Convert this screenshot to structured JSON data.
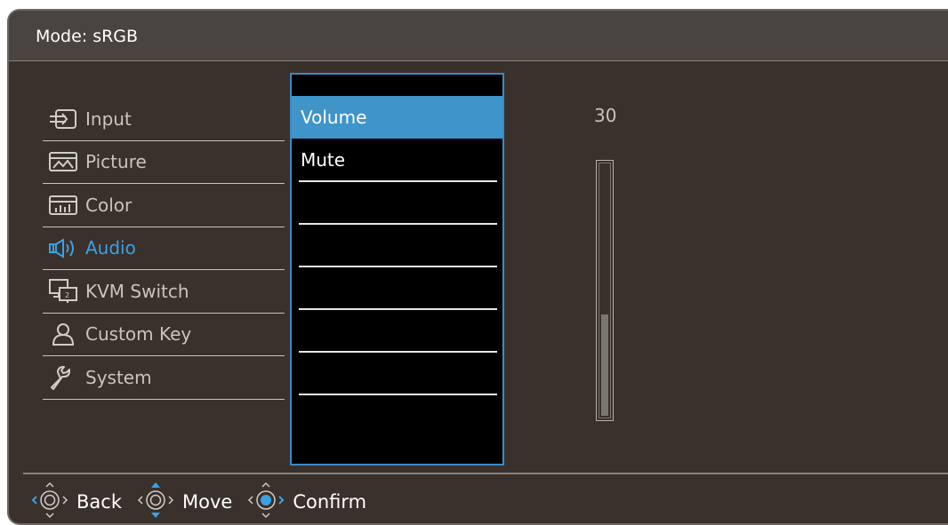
{
  "header": {
    "mode_label": "Mode: sRGB"
  },
  "menu": {
    "items": [
      {
        "label": "Input",
        "icon": "input-icon",
        "active": false
      },
      {
        "label": "Picture",
        "icon": "picture-icon",
        "active": false
      },
      {
        "label": "Color",
        "icon": "color-icon",
        "active": false
      },
      {
        "label": "Audio",
        "icon": "audio-icon",
        "active": true
      },
      {
        "label": "KVM Switch",
        "icon": "kvm-switch-icon",
        "active": false
      },
      {
        "label": "Custom Key",
        "icon": "custom-key-icon",
        "active": false
      },
      {
        "label": "System",
        "icon": "system-icon",
        "active": false
      }
    ]
  },
  "submenu": {
    "items": [
      {
        "label": "Volume",
        "selected": true
      },
      {
        "label": "Mute",
        "selected": false
      },
      {
        "label": "",
        "selected": false
      },
      {
        "label": "",
        "selected": false
      },
      {
        "label": "",
        "selected": false
      },
      {
        "label": "",
        "selected": false
      },
      {
        "label": "",
        "selected": false
      }
    ]
  },
  "volume": {
    "value": "30",
    "level_fraction": 0.4
  },
  "footer": {
    "back_label": "Back",
    "move_label": "Move",
    "confirm_label": "Confirm"
  },
  "colors": {
    "accent": "#3aa2e3",
    "selected_bg": "#3f94c9",
    "panel_bg": "#3a302c"
  }
}
